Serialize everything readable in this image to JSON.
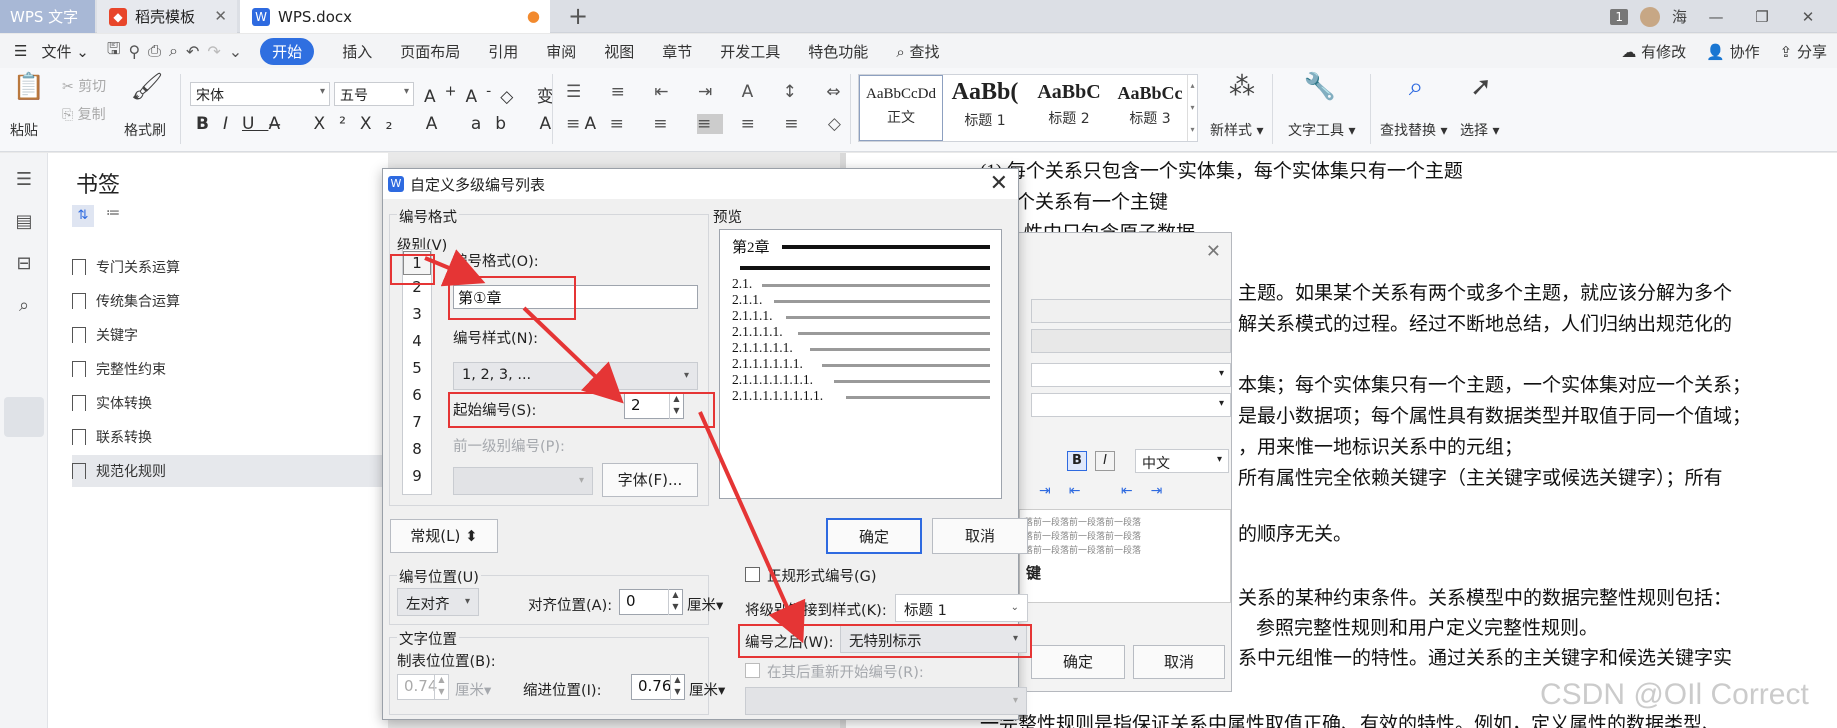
{
  "tabs": {
    "app": "WPS 文字",
    "template": "稻壳模板",
    "doc": "WPS.docx",
    "page_count": "1",
    "user": "海"
  },
  "menu": {
    "file": "文件",
    "items": [
      "开始",
      "插入",
      "页面布局",
      "引用",
      "审阅",
      "视图",
      "章节",
      "开发工具",
      "特色功能"
    ],
    "search": "查找",
    "right": [
      "有修改",
      "协作",
      "分享"
    ]
  },
  "ribbon": {
    "paste": "粘贴",
    "cut": "剪切",
    "copy": "复制",
    "format_painter": "格式刷",
    "font_name": "宋体",
    "font_size": "五号",
    "styles": [
      {
        "sample": "AaBbCcDd",
        "name": "正文"
      },
      {
        "sample": "AaBb(",
        "name": "标题 1"
      },
      {
        "sample": "AaBbC",
        "name": "标题 2"
      },
      {
        "sample": "AaBbCc",
        "name": "标题 3"
      }
    ],
    "new_style": "新样式",
    "text_tools": "文字工具",
    "find_replace": "查找替换",
    "select": "选择"
  },
  "bookmarks": {
    "title": "书签",
    "items": [
      "专门关系运算",
      "传统集合运算",
      "关键字",
      "完整性约束",
      "实体转换",
      "联系转换",
      "规范化规则"
    ]
  },
  "document": {
    "lines": [
      "(1) 每个关系只包含一个实体集，每个实体集只有一个主题",
      "个关系有一个主键",
      "性中只包含原子数据",
      "主题。如果某个关系有两个或多个主题，就应该分解为多个",
      "解关系模式的过程。经过不断地总结，人们归纳出规范化的",
      "本集；每个实体集只有一个主题，一个实体集对应一个关系；",
      "是最小数据项；每个属性具有数据类型并取值于同一个值域；",
      "，用来惟一地标识关系中的元组；",
      "所有属性完全依赖关键字（主关键字或候选关键字）；所有",
      "的顺序无关。",
      "关系的某种约束条件。关系模型中的数据完整性规则包括：",
      "参照完整性规则和用户定义完整性规则。",
      "系中元组惟一的特性。通过关系的主关键字和候选关键字实",
      "一完整性规则是指保证关系中属性取值正确、有效的特性。例如，定义属性的数据类型、"
    ]
  },
  "bg_dialog": {
    "lang": "中文",
    "bold": "B",
    "italic": "I",
    "sample_lines": [
      "落前一段落前一段落前一段落",
      "落前一段落前一段落前一段落",
      "落前一段落前一段落前一段落"
    ],
    "key": "键",
    "ok": "确定",
    "cancel": "取消"
  },
  "dialog": {
    "title": "自定义多级编号列表",
    "group_format": "编号格式",
    "level_label": "级别(V)",
    "levels": [
      "1",
      "2",
      "3",
      "4",
      "5",
      "6",
      "7",
      "8",
      "9"
    ],
    "number_format_label": "编号格式(O):",
    "number_format_value": "第①章",
    "number_style_label": "编号样式(N):",
    "number_style_value": "1, 2, 3, ...",
    "start_at_label": "起始编号(S):",
    "start_at_value": "2",
    "prev_level_label": "前一级别编号(P):",
    "font_button": "字体(F)...",
    "preview_label": "预览",
    "preview_heading": "第2章",
    "preview_items": [
      "2.1.",
      "2.1.1.",
      "2.1.1.1.",
      "2.1.1.1.1.",
      "2.1.1.1.1.1.",
      "2.1.1.1.1.1.1.",
      "2.1.1.1.1.1.1.1.",
      "2.1.1.1.1.1.1.1.1."
    ],
    "ok": "确定",
    "cancel": "取消",
    "general_button": "常规(L)",
    "legal_style": "正规形式编号(G)",
    "link_label": "将级别链接到样式(K):",
    "link_value": "标题 1",
    "follow_label": "编号之后(W):",
    "follow_value": "无特别标示",
    "restart_label": "在其后重新开始编号(R):",
    "pos_group": "编号位置(U)",
    "align_value": "左对齐",
    "align_at_label": "对齐位置(A):",
    "align_at_value": "0",
    "unit": "厘米",
    "text_pos_group": "文字位置",
    "tab_label": "制表位位置(B):",
    "tab_value": "0.74",
    "indent_label": "缩进位置(I):",
    "indent_value": "0.76"
  },
  "watermark": "CSDN @OIl Correct",
  "colors": {
    "accent": "#2f6fe0",
    "annotation_red": "#e53535"
  }
}
